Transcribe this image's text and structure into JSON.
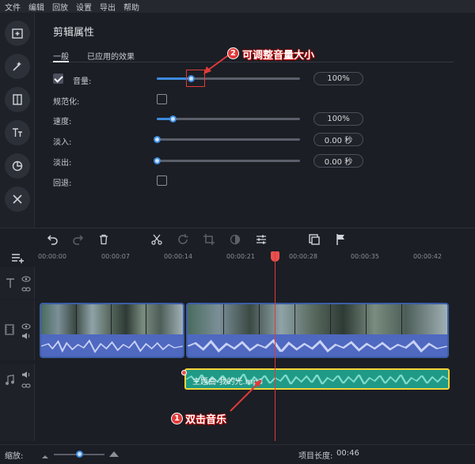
{
  "menu": [
    "文件",
    "编辑",
    "回放",
    "设置",
    "导出",
    "帮助"
  ],
  "sidebar_icons": [
    "add-media-icon",
    "magic-wand-icon",
    "transition-icon",
    "text-icon",
    "sticker-icon",
    "tools-icon"
  ],
  "properties": {
    "title": "剪辑属性",
    "tabs": [
      "一般",
      "已应用的效果"
    ],
    "active_tab": "一般",
    "rows": [
      {
        "label": "音量:",
        "type": "slider",
        "checked": true,
        "value_text": "100%",
        "level": 0.24
      },
      {
        "label": "规范化:",
        "type": "checkbox",
        "checked": false
      },
      {
        "label": "速度:",
        "type": "slider",
        "value_text": "100%",
        "level": 0.11
      },
      {
        "label": "淡入:",
        "type": "slider",
        "value_text": "0.00 秒",
        "level": 0.0
      },
      {
        "label": "淡出:",
        "type": "slider",
        "value_text": "0.00 秒",
        "level": 0.0
      },
      {
        "label": "回退:",
        "type": "checkbox",
        "checked": false
      }
    ]
  },
  "annotations": {
    "top": {
      "num": "2",
      "text": "可调整音量大小"
    },
    "bottom": {
      "num": "1",
      "text": "双击音乐"
    }
  },
  "toolbar_icons": [
    "undo-icon",
    "redo-icon",
    "delete-icon",
    "cut-icon",
    "rotate-icon",
    "crop-icon",
    "color-icon",
    "adjust-icon",
    "insert-icon",
    "marker-icon"
  ],
  "timeline": {
    "ticks": [
      "00:00:00",
      "00:00:07",
      "00:00:14",
      "00:00:21",
      "00:00:28",
      "00:00:35",
      "00:00:42"
    ],
    "audio_clip_name": "主题曲-我的光.mp3"
  },
  "bottom": {
    "zoom_label": "缩放:",
    "zoom_level": 0.5,
    "project_length_label": "项目长度:",
    "project_length": "00:46"
  },
  "colors": {
    "accent": "#3c8be0",
    "annotation": "#e03a3a",
    "audio_clip": "#1f9a87",
    "audio_border": "#f2d43a",
    "video_wave": "#4f68c0"
  }
}
